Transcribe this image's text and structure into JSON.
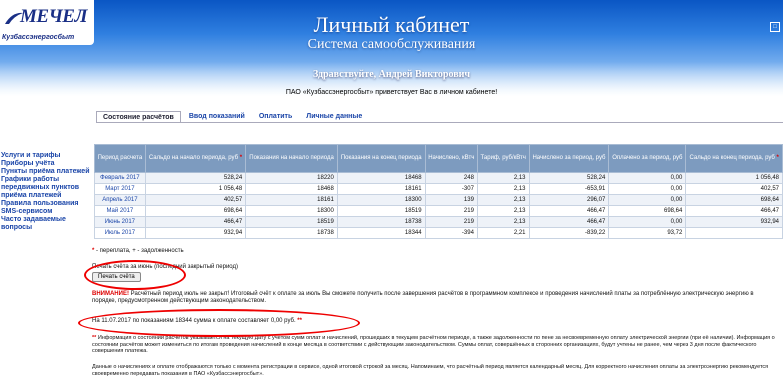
{
  "header": {
    "logo_name": "МЕЧЕЛ",
    "logo_sub": "Кузбассэнергосбыт",
    "title": "Личный кабинет",
    "subtitle": "Система самообслуживания",
    "greeting": "Здравствуйте, Андрей Викторович",
    "welcome": "ПАО «Кузбассэнергосбыт» приветствует Вас в личном кабинете!"
  },
  "tabs": [
    {
      "label": "Состояние расчётов",
      "active": true
    },
    {
      "label": "Ввод показаний",
      "active": false
    },
    {
      "label": "Оплатить",
      "active": false
    },
    {
      "label": "Личные данные",
      "active": false
    }
  ],
  "sidebar": [
    "Услуги и тарифы",
    "Приборы учёта",
    "Пункты приёма платежей",
    "Графики работы передвижных пунктов приёма платежей",
    "Правила пользования SMS-сервисом",
    "Часто задаваемые вопросы"
  ],
  "table": {
    "headers": [
      "Период расчета",
      "Сальдо на начало периода, руб",
      "Показания на начало периода",
      "Показания на конец периода",
      "Начислено, кВтч",
      "Тариф, руб/кВтч",
      "Начислено за период, руб",
      "Оплачено за период, руб",
      "Сальдо на конец периода, руб"
    ],
    "rows": [
      [
        "Февраль 2017",
        "528,24",
        "18220",
        "18468",
        "248",
        "2,13",
        "528,24",
        "0,00",
        "1 056,48"
      ],
      [
        "Март 2017",
        "1 056,48",
        "18468",
        "18161",
        "-307",
        "2,13",
        "-653,91",
        "0,00",
        "402,57"
      ],
      [
        "Апрель 2017",
        "402,57",
        "18161",
        "18300",
        "139",
        "2,13",
        "296,07",
        "0,00",
        "698,64"
      ],
      [
        "Май 2017",
        "698,64",
        "18300",
        "18519",
        "219",
        "2,13",
        "466,47",
        "698,64",
        "466,47"
      ],
      [
        "Июнь 2017",
        "466,47",
        "18519",
        "18738",
        "219",
        "2,13",
        "466,47",
        "0,00",
        "932,94"
      ],
      [
        "Июль 2017",
        "932,94",
        "18738",
        "18344",
        "-394",
        "2,21",
        "-839,22",
        "93,72",
        ""
      ]
    ]
  },
  "legend": "- переплата, + - задолженность",
  "print": {
    "label": "Печать счёта за июнь (последний закрытый период)",
    "button": "Печать счёта"
  },
  "warning": {
    "prefix": "ВНИМАНИЕ!",
    "text": " Расчётный период июль не закрыт! Итоговый счёт к оплате за июль Вы сможете получить после завершения расчётов в программном комплексе и проведения начислений платы за потреблённую электрическую энергию в порядке, предусмотренном действующим законодательством."
  },
  "summary": {
    "text": "На 11.07.2017 по показаниям 18344 сумма к оплате составляет 0,00 руб."
  },
  "note": "Информация о состоянии расчётов указывается на текущую дату с учётом сумм оплат и начислений, прошедших в текущем расчётном периоде, а также задолженности по пене за несвоевременную оплату электрической энергии (при её наличии). Информация о состоянии расчётов может измениться по итогам проведения начислений в конце месяца в соответствии с действующим законодательством. Суммы оплат, совершённых в сторонних организациях, будут учтены не ранее, чем через 3 дня после фактического совершения платежа.",
  "note2": "Данные о начислениях и оплате отображаются только с момента регистрации в сервисе, одной итоговой строкой за месяц. Напоминаем, что расчётный период является календарный месяц. Для корректного начисления оплаты за электроэнергию рекомендуется своевременно передавать показания в ПАО «Кузбассэнергосбыт».",
  "colors": {
    "accent": "#1a45a8",
    "header_blue": "#0a56c4",
    "table_header": "#7d9bbf",
    "highlight": "#e00000"
  }
}
